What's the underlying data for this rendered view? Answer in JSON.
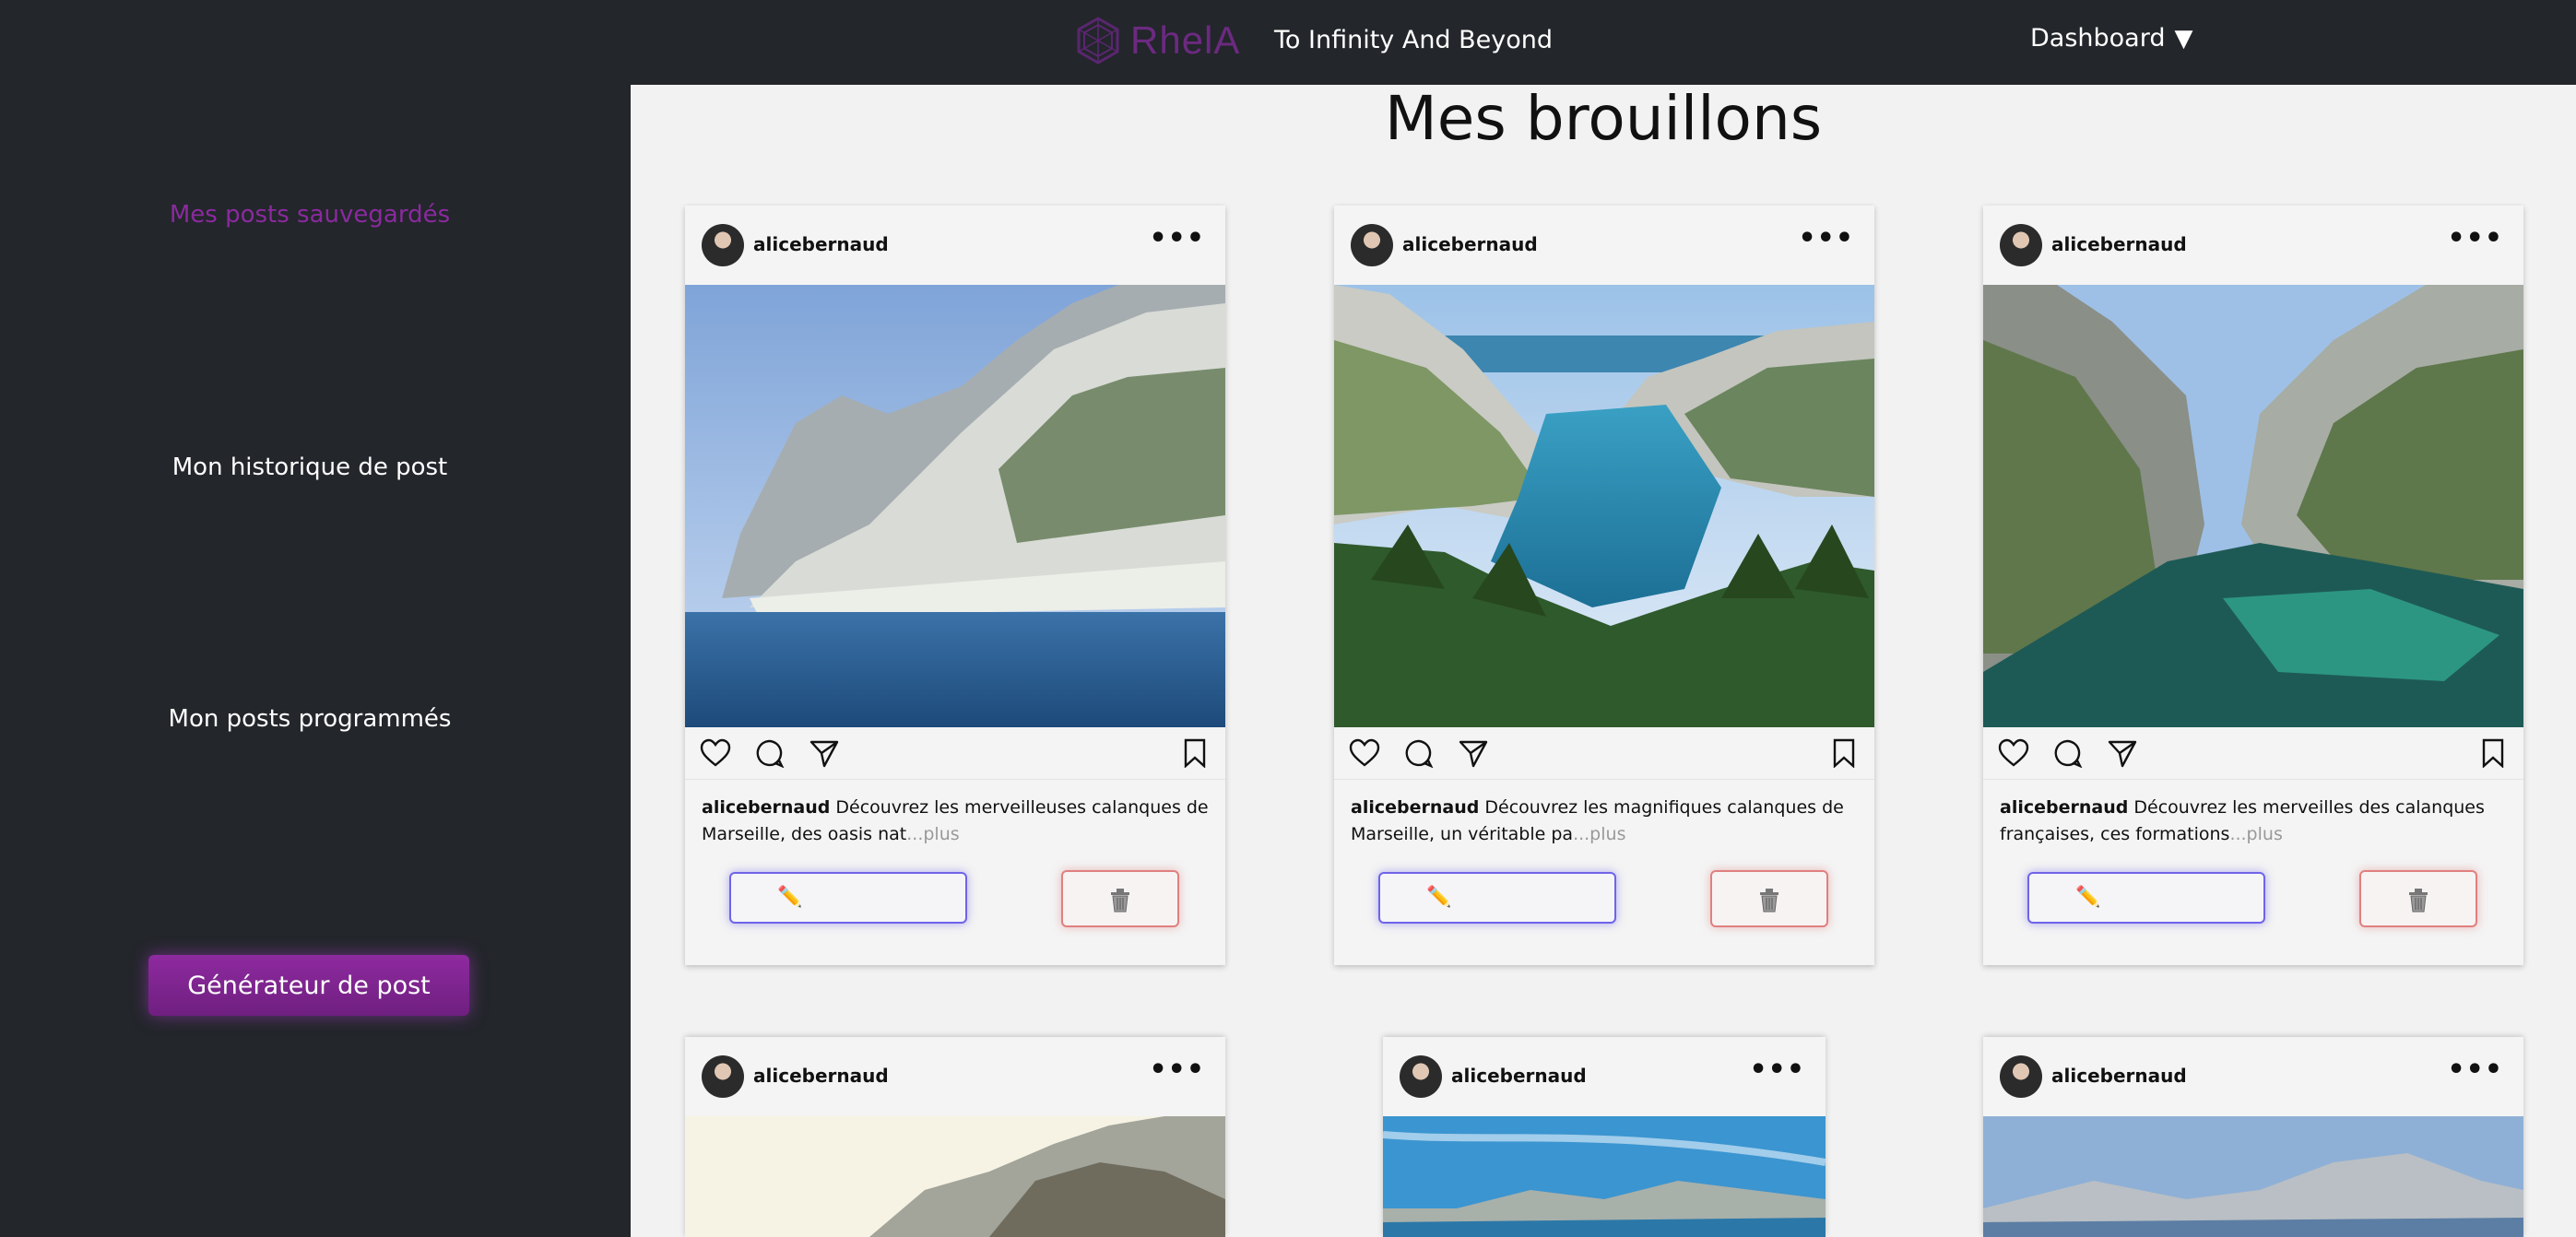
{
  "header": {
    "logo_text": "RhelA",
    "tagline": "To Infinity And Beyond",
    "dashboard_label": "Dashboard",
    "accent_color": "#6b2a80",
    "bg_color": "#23262b"
  },
  "sidebar": {
    "items": [
      {
        "label": "Mes posts sauvegardés",
        "active": true
      },
      {
        "label": "Mon historique de post",
        "active": false
      },
      {
        "label": "Mon posts programmés",
        "active": false
      }
    ],
    "generator_button": "Générateur de post"
  },
  "main": {
    "title": "Mes brouillons",
    "cards": [
      {
        "username": "alicebernaud",
        "caption": "Découvrez les merveilleuses calanques de Marseille, des oasis nat",
        "more": "...plus"
      },
      {
        "username": "alicebernaud",
        "caption": "Découvrez les magnifiques calanques de Marseille, un véritable pa",
        "more": "...plus"
      },
      {
        "username": "alicebernaud",
        "caption": "Découvrez les merveilles des calanques françaises, ces formations",
        "more": "...plus"
      },
      {
        "username": "alicebernaud"
      },
      {
        "username": "alicebernaud"
      },
      {
        "username": "alicebernaud"
      }
    ],
    "edit_icon": "pencil-icon",
    "delete_icon": "trash-icon"
  }
}
